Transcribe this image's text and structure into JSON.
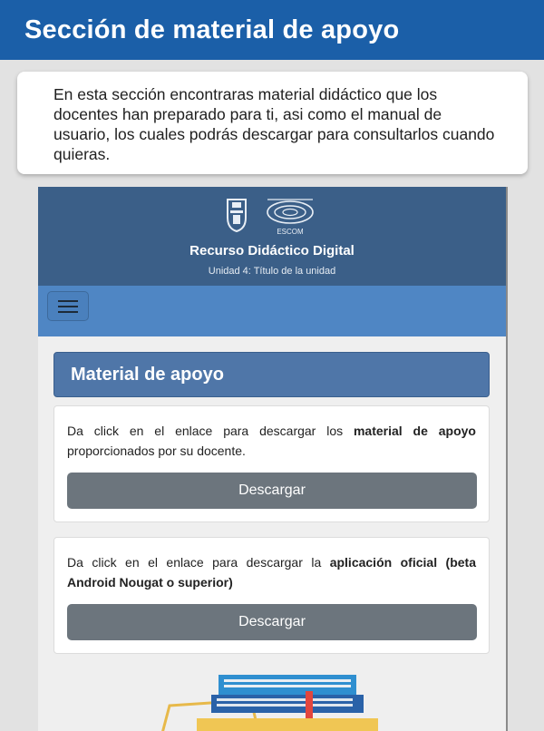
{
  "banner": {
    "title": "Sección de material de apoyo"
  },
  "intro": {
    "text": "En esta sección encontraras material didáctico que los docentes han preparado para ti, asi como el manual de usuario, los cuales podrás descargar para consultarlos cuando quieras."
  },
  "app": {
    "logos": {
      "left": "ipn-logo-icon",
      "right": "escom-logo-icon",
      "right_text": "ESCOM"
    },
    "title": "Recurso Didáctico Digital",
    "subtitle": "Unidad 4: Título de la unidad",
    "menu_icon": "hamburger-menu-icon"
  },
  "section": {
    "heading": "Material de apoyo"
  },
  "cards": [
    {
      "text_before": "Da click en el enlace para descargar los ",
      "text_bold": "material de apoyo",
      "text_after": " proporcionados por su docente.",
      "button_label": "Descargar"
    },
    {
      "text_before": "Da click en el enlace para descargar la ",
      "text_bold": "aplicación oficial (beta Android Nougat o superior)",
      "text_after": "",
      "button_label": "Descargar"
    }
  ],
  "illustration": "books-illustration",
  "colors": {
    "banner": "#1b5fa8",
    "app_header": "#3b5f88",
    "navbar": "#4f86c4",
    "section_heading": "#4f76a8",
    "button": "#6c757d"
  }
}
